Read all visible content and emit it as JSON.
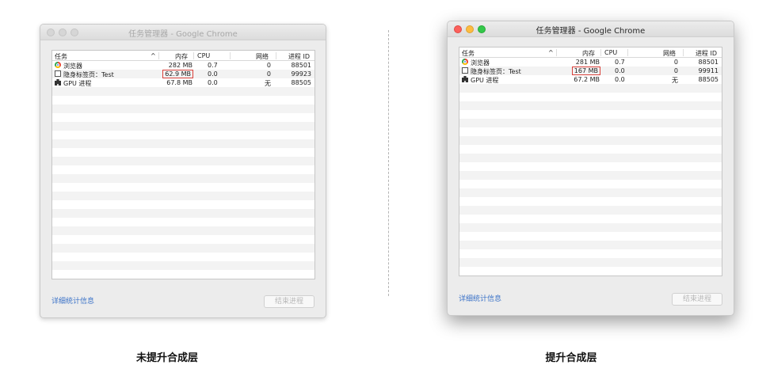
{
  "panels": [
    {
      "window_title": "任务管理器 - Google Chrome",
      "columns": {
        "task": "任务",
        "sort_arrow": "^",
        "memory": "内存",
        "cpu": "CPU",
        "network": "网络",
        "pid": "进程 ID"
      },
      "rows": [
        {
          "icon": "chrome-icon",
          "task": "浏览器",
          "memory": "282 MB",
          "cpu": "0.7",
          "network": "0",
          "pid": "88501",
          "memory_highlighted": false
        },
        {
          "icon": "document-icon",
          "task": "隐身标签页：Test",
          "memory": "62.9 MB",
          "cpu": "0.0",
          "network": "0",
          "pid": "99923",
          "memory_highlighted": true
        },
        {
          "icon": "puzzle-icon",
          "task": "GPU 进程",
          "memory": "67.8 MB",
          "cpu": "0.0",
          "network": "无",
          "pid": "88505",
          "memory_highlighted": false
        }
      ],
      "details_link": "详细统计信息",
      "end_process_button": "结束进程",
      "caption": "未提升合成层"
    },
    {
      "window_title": "任务管理器 - Google Chrome",
      "columns": {
        "task": "任务",
        "sort_arrow": "^",
        "memory": "内存",
        "cpu": "CPU",
        "network": "网络",
        "pid": "进程 ID"
      },
      "rows": [
        {
          "icon": "chrome-icon",
          "task": "浏览器",
          "memory": "281 MB",
          "cpu": "0.7",
          "network": "0",
          "pid": "88501",
          "memory_highlighted": false
        },
        {
          "icon": "document-icon",
          "task": "隐身标签页：Test",
          "memory": "167 MB",
          "cpu": "0.0",
          "network": "0",
          "pid": "99911",
          "memory_highlighted": true
        },
        {
          "icon": "puzzle-icon",
          "task": "GPU 进程",
          "memory": "67.2 MB",
          "cpu": "0.0",
          "network": "无",
          "pid": "88505",
          "memory_highlighted": false
        }
      ],
      "details_link": "详细统计信息",
      "end_process_button": "结束进程",
      "caption": "提升合成层"
    }
  ],
  "colors": {
    "highlight_box": "#d9403a",
    "link": "#3c73c8",
    "traffic_close": "#fc605c",
    "traffic_minimize": "#fdbc40",
    "traffic_zoom": "#34c84a"
  }
}
